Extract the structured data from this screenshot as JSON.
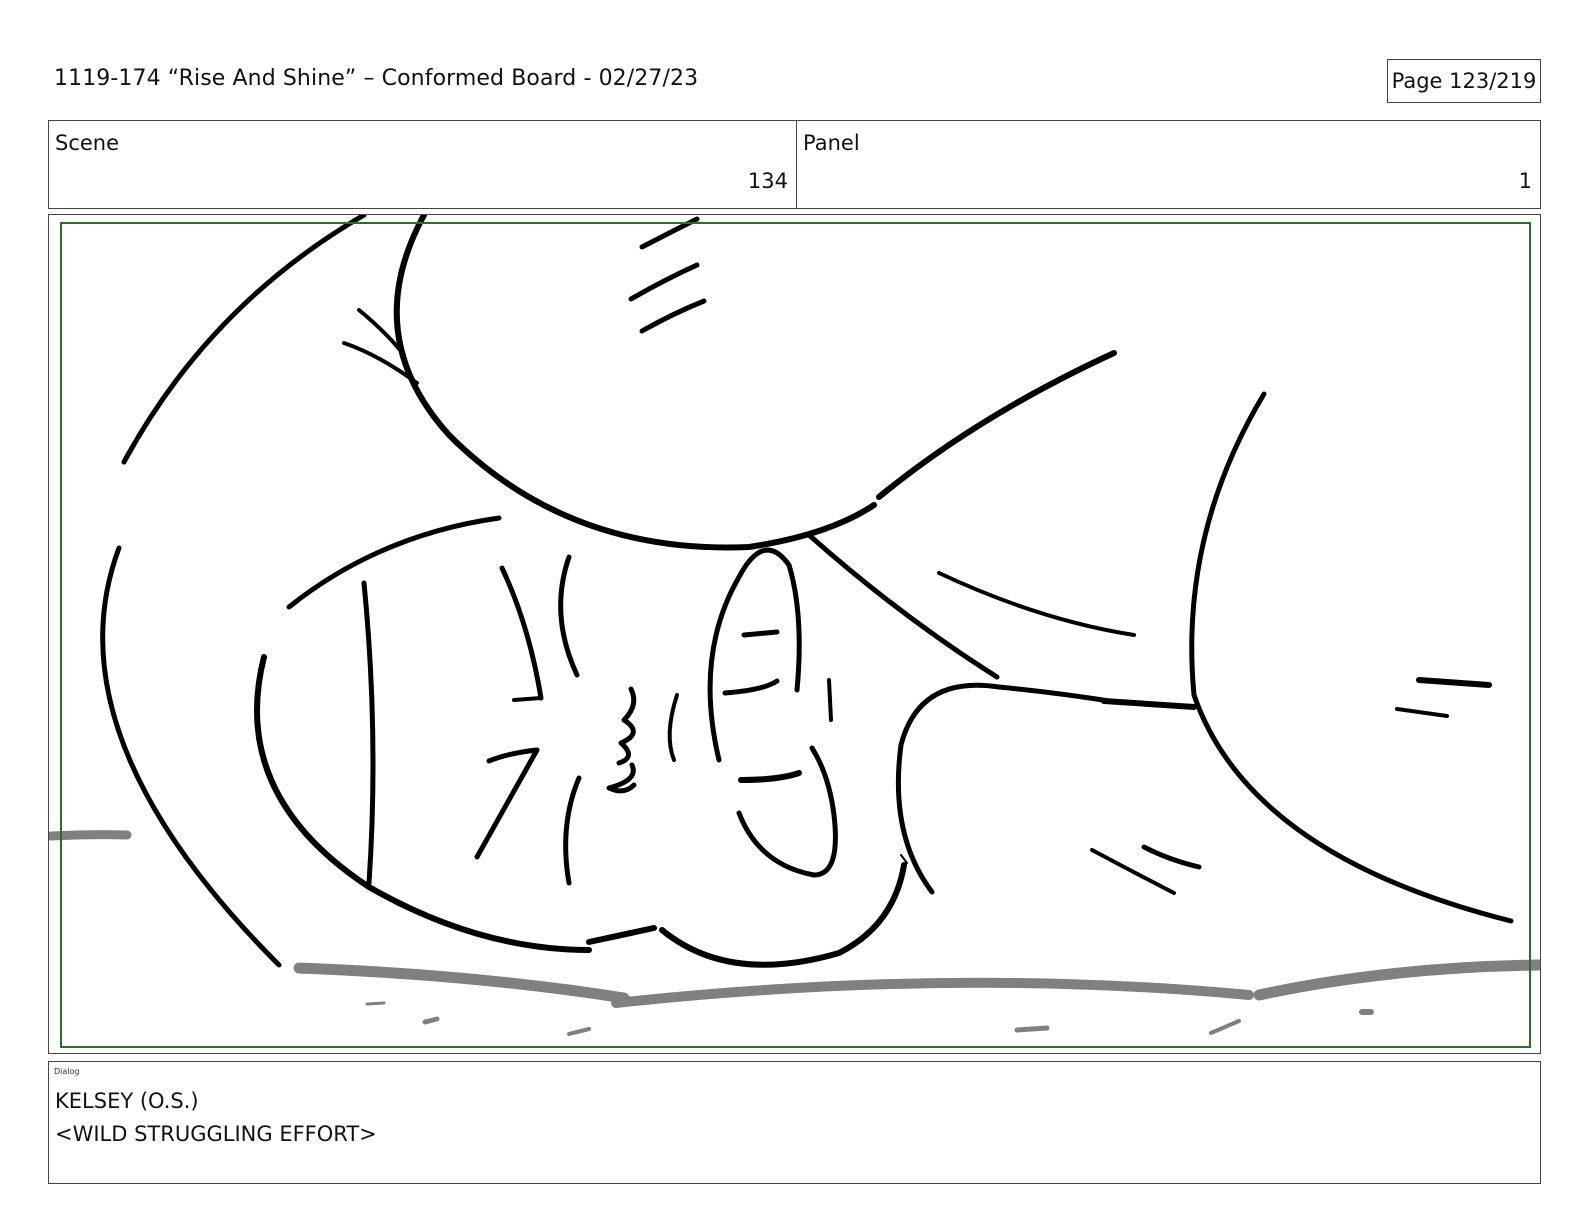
{
  "header": {
    "title": "1119-174 “Rise And Shine” – Conformed Board - 02/27/23",
    "page": "Page 123/219"
  },
  "info": {
    "scene_label": "Scene",
    "scene_value": "134",
    "panel_label": "Panel",
    "panel_value": "1"
  },
  "panel": {
    "drawing": "storyboard-sketch",
    "safe_area_color": "#2e6b2e",
    "line_color": "#000000",
    "ground_color": "#808080"
  },
  "dialog": {
    "label": "Dialog",
    "lines": [
      "KELSEY (O.S.)",
      "<WILD STRUGGLING EFFORT>"
    ]
  }
}
